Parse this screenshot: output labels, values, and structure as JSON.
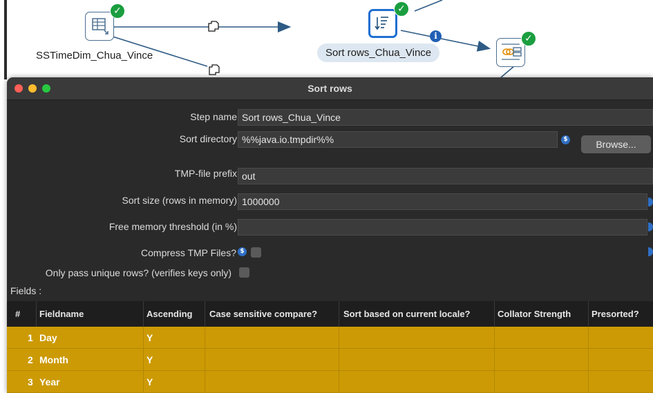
{
  "canvas": {
    "steps": [
      {
        "label": "SSTimeDim_Chua_Vince",
        "icon": "table-input-icon"
      },
      {
        "label": "Sort rows_Chua_Vince",
        "icon": "sort-rows-icon"
      },
      {
        "label": "",
        "icon": "merge-join-icon"
      }
    ],
    "info_badge": "i",
    "check_glyph": "✓"
  },
  "dialog": {
    "title": "Sort rows",
    "form": {
      "step_name": {
        "label": "Step name",
        "value": "Sort rows_Chua_Vince"
      },
      "sort_directory": {
        "label": "Sort directory",
        "value": "%%java.io.tmpdir%%",
        "browse_label": "Browse..."
      },
      "tmp_prefix": {
        "label": "TMP-file prefix",
        "value": "out"
      },
      "sort_size": {
        "label": "Sort size (rows in memory)",
        "value": "1000000"
      },
      "free_memory": {
        "label": "Free memory threshold (in %)",
        "value": ""
      },
      "compress_tmp": {
        "label": "Compress TMP Files?",
        "checked": false
      },
      "unique_rows": {
        "label": "Only pass unique rows? (verifies keys only)",
        "checked": false
      },
      "fields_label": "Fields :"
    },
    "variable_glyph": "$",
    "table": {
      "columns": [
        "#",
        "Fieldname",
        "Ascending",
        "Case sensitive compare?",
        "Sort based on current locale?",
        "Collator Strength",
        "Presorted?"
      ],
      "rows": [
        {
          "num": "1",
          "fieldname": "Day",
          "ascending": "Y"
        },
        {
          "num": "2",
          "fieldname": "Month",
          "ascending": "Y"
        },
        {
          "num": "3",
          "fieldname": "Year",
          "ascending": "Y"
        }
      ],
      "row_color": "#cc9a04"
    }
  }
}
